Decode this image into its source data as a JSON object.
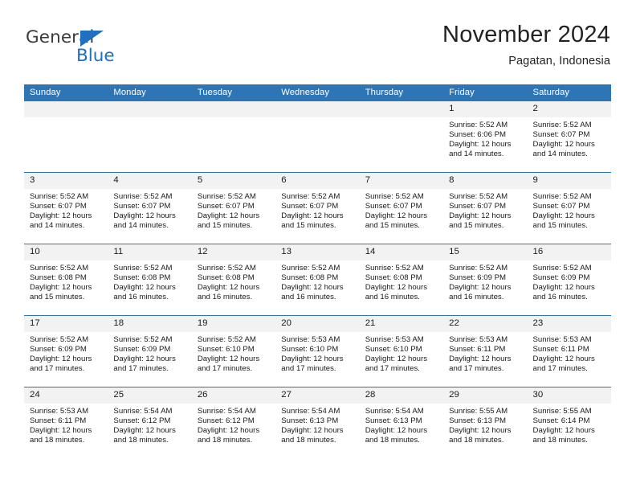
{
  "brand": {
    "name_part1": "General",
    "name_part2": "Blue",
    "accent_color": "#1f70c1",
    "triangle_icon": "triangle-icon"
  },
  "header": {
    "title": "November 2024",
    "subtitle": "Pagatan, Indonesia"
  },
  "calendar": {
    "header_bg": "#2e75b6",
    "daynum_bg": "#f2f2f2",
    "weekday_headers": [
      "Sunday",
      "Monday",
      "Tuesday",
      "Wednesday",
      "Thursday",
      "Friday",
      "Saturday"
    ],
    "weeks": [
      [
        {
          "day": "",
          "sunrise": "",
          "sunset": "",
          "daylight_line1": "",
          "daylight_line2": "",
          "empty": true
        },
        {
          "day": "",
          "sunrise": "",
          "sunset": "",
          "daylight_line1": "",
          "daylight_line2": "",
          "empty": true
        },
        {
          "day": "",
          "sunrise": "",
          "sunset": "",
          "daylight_line1": "",
          "daylight_line2": "",
          "empty": true
        },
        {
          "day": "",
          "sunrise": "",
          "sunset": "",
          "daylight_line1": "",
          "daylight_line2": "",
          "empty": true
        },
        {
          "day": "",
          "sunrise": "",
          "sunset": "",
          "daylight_line1": "",
          "daylight_line2": "",
          "empty": true
        },
        {
          "day": "1",
          "sunrise": "Sunrise: 5:52 AM",
          "sunset": "Sunset: 6:06 PM",
          "daylight_line1": "Daylight: 12 hours",
          "daylight_line2": "and 14 minutes.",
          "empty": false
        },
        {
          "day": "2",
          "sunrise": "Sunrise: 5:52 AM",
          "sunset": "Sunset: 6:07 PM",
          "daylight_line1": "Daylight: 12 hours",
          "daylight_line2": "and 14 minutes.",
          "empty": false
        }
      ],
      [
        {
          "day": "3",
          "sunrise": "Sunrise: 5:52 AM",
          "sunset": "Sunset: 6:07 PM",
          "daylight_line1": "Daylight: 12 hours",
          "daylight_line2": "and 14 minutes.",
          "empty": false
        },
        {
          "day": "4",
          "sunrise": "Sunrise: 5:52 AM",
          "sunset": "Sunset: 6:07 PM",
          "daylight_line1": "Daylight: 12 hours",
          "daylight_line2": "and 14 minutes.",
          "empty": false
        },
        {
          "day": "5",
          "sunrise": "Sunrise: 5:52 AM",
          "sunset": "Sunset: 6:07 PM",
          "daylight_line1": "Daylight: 12 hours",
          "daylight_line2": "and 15 minutes.",
          "empty": false
        },
        {
          "day": "6",
          "sunrise": "Sunrise: 5:52 AM",
          "sunset": "Sunset: 6:07 PM",
          "daylight_line1": "Daylight: 12 hours",
          "daylight_line2": "and 15 minutes.",
          "empty": false
        },
        {
          "day": "7",
          "sunrise": "Sunrise: 5:52 AM",
          "sunset": "Sunset: 6:07 PM",
          "daylight_line1": "Daylight: 12 hours",
          "daylight_line2": "and 15 minutes.",
          "empty": false
        },
        {
          "day": "8",
          "sunrise": "Sunrise: 5:52 AM",
          "sunset": "Sunset: 6:07 PM",
          "daylight_line1": "Daylight: 12 hours",
          "daylight_line2": "and 15 minutes.",
          "empty": false
        },
        {
          "day": "9",
          "sunrise": "Sunrise: 5:52 AM",
          "sunset": "Sunset: 6:07 PM",
          "daylight_line1": "Daylight: 12 hours",
          "daylight_line2": "and 15 minutes.",
          "empty": false
        }
      ],
      [
        {
          "day": "10",
          "sunrise": "Sunrise: 5:52 AM",
          "sunset": "Sunset: 6:08 PM",
          "daylight_line1": "Daylight: 12 hours",
          "daylight_line2": "and 15 minutes.",
          "empty": false
        },
        {
          "day": "11",
          "sunrise": "Sunrise: 5:52 AM",
          "sunset": "Sunset: 6:08 PM",
          "daylight_line1": "Daylight: 12 hours",
          "daylight_line2": "and 16 minutes.",
          "empty": false
        },
        {
          "day": "12",
          "sunrise": "Sunrise: 5:52 AM",
          "sunset": "Sunset: 6:08 PM",
          "daylight_line1": "Daylight: 12 hours",
          "daylight_line2": "and 16 minutes.",
          "empty": false
        },
        {
          "day": "13",
          "sunrise": "Sunrise: 5:52 AM",
          "sunset": "Sunset: 6:08 PM",
          "daylight_line1": "Daylight: 12 hours",
          "daylight_line2": "and 16 minutes.",
          "empty": false
        },
        {
          "day": "14",
          "sunrise": "Sunrise: 5:52 AM",
          "sunset": "Sunset: 6:08 PM",
          "daylight_line1": "Daylight: 12 hours",
          "daylight_line2": "and 16 minutes.",
          "empty": false
        },
        {
          "day": "15",
          "sunrise": "Sunrise: 5:52 AM",
          "sunset": "Sunset: 6:09 PM",
          "daylight_line1": "Daylight: 12 hours",
          "daylight_line2": "and 16 minutes.",
          "empty": false
        },
        {
          "day": "16",
          "sunrise": "Sunrise: 5:52 AM",
          "sunset": "Sunset: 6:09 PM",
          "daylight_line1": "Daylight: 12 hours",
          "daylight_line2": "and 16 minutes.",
          "empty": false
        }
      ],
      [
        {
          "day": "17",
          "sunrise": "Sunrise: 5:52 AM",
          "sunset": "Sunset: 6:09 PM",
          "daylight_line1": "Daylight: 12 hours",
          "daylight_line2": "and 17 minutes.",
          "empty": false
        },
        {
          "day": "18",
          "sunrise": "Sunrise: 5:52 AM",
          "sunset": "Sunset: 6:09 PM",
          "daylight_line1": "Daylight: 12 hours",
          "daylight_line2": "and 17 minutes.",
          "empty": false
        },
        {
          "day": "19",
          "sunrise": "Sunrise: 5:52 AM",
          "sunset": "Sunset: 6:10 PM",
          "daylight_line1": "Daylight: 12 hours",
          "daylight_line2": "and 17 minutes.",
          "empty": false
        },
        {
          "day": "20",
          "sunrise": "Sunrise: 5:53 AM",
          "sunset": "Sunset: 6:10 PM",
          "daylight_line1": "Daylight: 12 hours",
          "daylight_line2": "and 17 minutes.",
          "empty": false
        },
        {
          "day": "21",
          "sunrise": "Sunrise: 5:53 AM",
          "sunset": "Sunset: 6:10 PM",
          "daylight_line1": "Daylight: 12 hours",
          "daylight_line2": "and 17 minutes.",
          "empty": false
        },
        {
          "day": "22",
          "sunrise": "Sunrise: 5:53 AM",
          "sunset": "Sunset: 6:11 PM",
          "daylight_line1": "Daylight: 12 hours",
          "daylight_line2": "and 17 minutes.",
          "empty": false
        },
        {
          "day": "23",
          "sunrise": "Sunrise: 5:53 AM",
          "sunset": "Sunset: 6:11 PM",
          "daylight_line1": "Daylight: 12 hours",
          "daylight_line2": "and 17 minutes.",
          "empty": false
        }
      ],
      [
        {
          "day": "24",
          "sunrise": "Sunrise: 5:53 AM",
          "sunset": "Sunset: 6:11 PM",
          "daylight_line1": "Daylight: 12 hours",
          "daylight_line2": "and 18 minutes.",
          "empty": false
        },
        {
          "day": "25",
          "sunrise": "Sunrise: 5:54 AM",
          "sunset": "Sunset: 6:12 PM",
          "daylight_line1": "Daylight: 12 hours",
          "daylight_line2": "and 18 minutes.",
          "empty": false
        },
        {
          "day": "26",
          "sunrise": "Sunrise: 5:54 AM",
          "sunset": "Sunset: 6:12 PM",
          "daylight_line1": "Daylight: 12 hours",
          "daylight_line2": "and 18 minutes.",
          "empty": false
        },
        {
          "day": "27",
          "sunrise": "Sunrise: 5:54 AM",
          "sunset": "Sunset: 6:13 PM",
          "daylight_line1": "Daylight: 12 hours",
          "daylight_line2": "and 18 minutes.",
          "empty": false
        },
        {
          "day": "28",
          "sunrise": "Sunrise: 5:54 AM",
          "sunset": "Sunset: 6:13 PM",
          "daylight_line1": "Daylight: 12 hours",
          "daylight_line2": "and 18 minutes.",
          "empty": false
        },
        {
          "day": "29",
          "sunrise": "Sunrise: 5:55 AM",
          "sunset": "Sunset: 6:13 PM",
          "daylight_line1": "Daylight: 12 hours",
          "daylight_line2": "and 18 minutes.",
          "empty": false
        },
        {
          "day": "30",
          "sunrise": "Sunrise: 5:55 AM",
          "sunset": "Sunset: 6:14 PM",
          "daylight_line1": "Daylight: 12 hours",
          "daylight_line2": "and 18 minutes.",
          "empty": false
        }
      ]
    ]
  }
}
